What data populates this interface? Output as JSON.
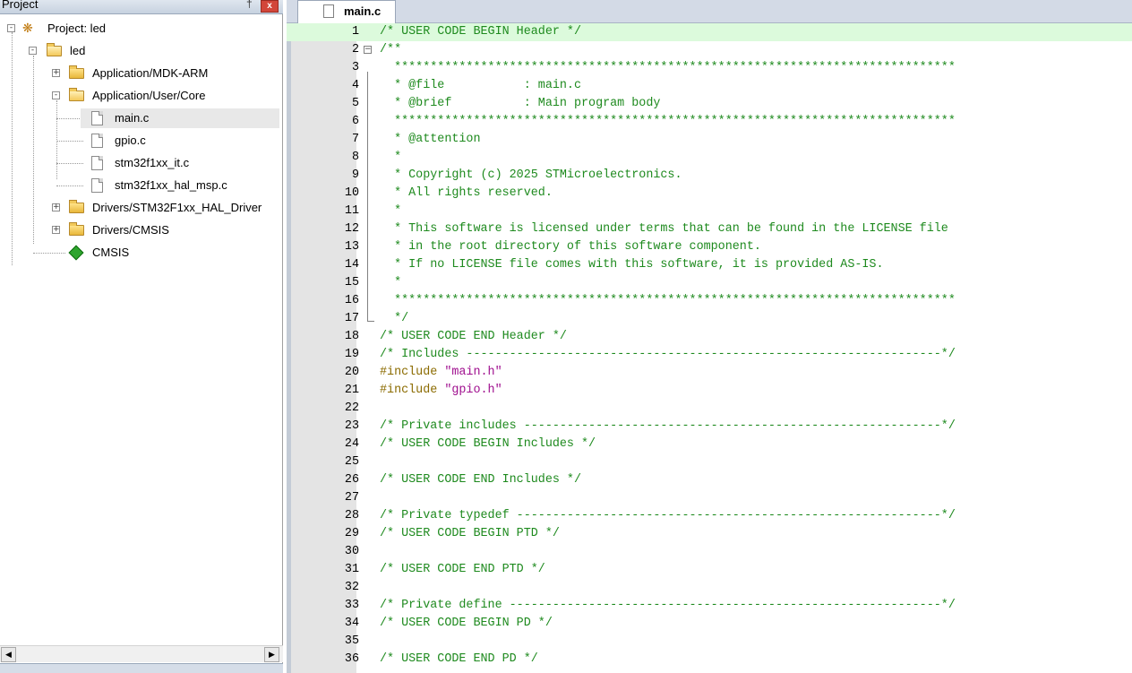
{
  "project_panel": {
    "title": "Project",
    "pin_glyph": "†",
    "close_glyph": "x",
    "tree": [
      {
        "label": "Project: led",
        "icon": "project-icon",
        "expander": "-"
      },
      {
        "label": "led",
        "icon": "target-icon",
        "expander": "-"
      },
      {
        "label": "Application/MDK-ARM",
        "icon": "folder-icon",
        "expander": "+"
      },
      {
        "label": "Application/User/Core",
        "icon": "folder-open-icon",
        "expander": "-"
      },
      {
        "label": "main.c",
        "icon": "file-icon",
        "selected": true
      },
      {
        "label": "gpio.c",
        "icon": "file-icon"
      },
      {
        "label": "stm32f1xx_it.c",
        "icon": "file-icon"
      },
      {
        "label": "stm32f1xx_hal_msp.c",
        "icon": "file-icon"
      },
      {
        "label": "Drivers/STM32F1xx_HAL_Driver",
        "icon": "folder-icon",
        "expander": "+"
      },
      {
        "label": "Drivers/CMSIS",
        "icon": "folder-icon",
        "expander": "+"
      },
      {
        "label": "CMSIS",
        "icon": "cmsis-component-icon"
      }
    ],
    "scroll_left_glyph": "◀",
    "scroll_right_glyph": "▶"
  },
  "editor": {
    "tab_label": "main.c",
    "current_line": 1,
    "lines": [
      {
        "n": "1",
        "text": "/* USER CODE BEGIN Header */",
        "kind": "comment"
      },
      {
        "n": "2",
        "text": "/**",
        "kind": "comment"
      },
      {
        "n": "3",
        "text": "  ******************************************************************************",
        "kind": "comment"
      },
      {
        "n": "4",
        "text": "  * @file           : main.c",
        "kind": "comment"
      },
      {
        "n": "5",
        "text": "  * @brief          : Main program body",
        "kind": "comment"
      },
      {
        "n": "6",
        "text": "  ******************************************************************************",
        "kind": "comment"
      },
      {
        "n": "7",
        "text": "  * @attention",
        "kind": "comment"
      },
      {
        "n": "8",
        "text": "  *",
        "kind": "comment"
      },
      {
        "n": "9",
        "text": "  * Copyright (c) 2025 STMicroelectronics.",
        "kind": "comment"
      },
      {
        "n": "10",
        "text": "  * All rights reserved.",
        "kind": "comment"
      },
      {
        "n": "11",
        "text": "  *",
        "kind": "comment"
      },
      {
        "n": "12",
        "text": "  * This software is licensed under terms that can be found in the LICENSE file",
        "kind": "comment"
      },
      {
        "n": "13",
        "text": "  * in the root directory of this software component.",
        "kind": "comment"
      },
      {
        "n": "14",
        "text": "  * If no LICENSE file comes with this software, it is provided AS-IS.",
        "kind": "comment"
      },
      {
        "n": "15",
        "text": "  *",
        "kind": "comment"
      },
      {
        "n": "16",
        "text": "  ******************************************************************************",
        "kind": "comment"
      },
      {
        "n": "17",
        "text": "  */",
        "kind": "comment"
      },
      {
        "n": "18",
        "text": "/* USER CODE END Header */",
        "kind": "comment"
      },
      {
        "n": "19",
        "text": "/* Includes ------------------------------------------------------------------*/",
        "kind": "comment"
      },
      {
        "n": "20",
        "text": "#include ",
        "kind": "include",
        "str": "\"main.h\""
      },
      {
        "n": "21",
        "text": "#include ",
        "kind": "include",
        "str": "\"gpio.h\""
      },
      {
        "n": "22",
        "text": "",
        "kind": "comment"
      },
      {
        "n": "23",
        "text": "/* Private includes ----------------------------------------------------------*/",
        "kind": "comment"
      },
      {
        "n": "24",
        "text": "/* USER CODE BEGIN Includes */",
        "kind": "comment"
      },
      {
        "n": "25",
        "text": "",
        "kind": "comment"
      },
      {
        "n": "26",
        "text": "/* USER CODE END Includes */",
        "kind": "comment"
      },
      {
        "n": "27",
        "text": "",
        "kind": "comment"
      },
      {
        "n": "28",
        "text": "/* Private typedef -----------------------------------------------------------*/",
        "kind": "comment"
      },
      {
        "n": "29",
        "text": "/* USER CODE BEGIN PTD */",
        "kind": "comment"
      },
      {
        "n": "30",
        "text": "",
        "kind": "comment"
      },
      {
        "n": "31",
        "text": "/* USER CODE END PTD */",
        "kind": "comment"
      },
      {
        "n": "32",
        "text": "",
        "kind": "comment"
      },
      {
        "n": "33",
        "text": "/* Private define ------------------------------------------------------------*/",
        "kind": "comment"
      },
      {
        "n": "34",
        "text": "/* USER CODE BEGIN PD */",
        "kind": "comment"
      },
      {
        "n": "35",
        "text": "",
        "kind": "comment"
      },
      {
        "n": "36",
        "text": "/* USER CODE END PD */",
        "kind": "comment"
      }
    ]
  },
  "colors": {
    "comment": "#1e8a1e",
    "preprocessor": "#8b6b00",
    "string": "#a0108f",
    "current_line_bg": "#dcfadc"
  }
}
